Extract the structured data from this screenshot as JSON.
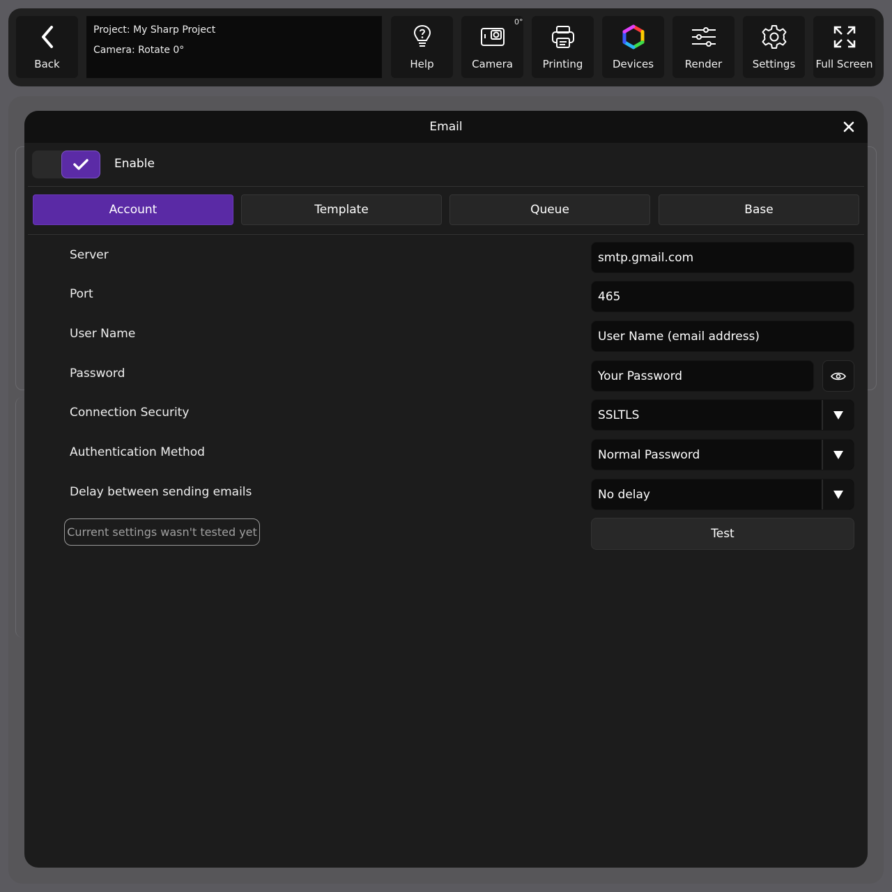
{
  "topbar": {
    "back_label": "Back",
    "project_line": "Project: My Sharp Project",
    "camera_line": "Camera: Rotate 0°",
    "camera_angle": "0°",
    "buttons": [
      {
        "label": "Help",
        "icon": "help-bulb-icon"
      },
      {
        "label": "Camera",
        "icon": "camera-icon"
      },
      {
        "label": "Printing",
        "icon": "printer-icon"
      },
      {
        "label": "Devices",
        "icon": "devices-rainbow-hexagon-icon"
      },
      {
        "label": "Render",
        "icon": "sliders-icon"
      },
      {
        "label": "Settings",
        "icon": "gear-icon"
      },
      {
        "label": "Full Screen",
        "icon": "fullscreen-icon"
      }
    ]
  },
  "dialog": {
    "title": "Email",
    "enable_label": "Enable",
    "enabled": true,
    "tabs": [
      {
        "label": "Account",
        "active": true
      },
      {
        "label": "Template",
        "active": false
      },
      {
        "label": "Queue",
        "active": false
      },
      {
        "label": "Base",
        "active": false
      }
    ],
    "fields": {
      "server": {
        "label": "Server",
        "value": "smtp.gmail.com"
      },
      "port": {
        "label": "Port",
        "value": "465"
      },
      "username": {
        "label": "User Name",
        "placeholder": "User Name (email address)"
      },
      "password": {
        "label": "Password",
        "placeholder": "Your Password"
      },
      "security": {
        "label": "Connection Security",
        "value": "SSLTLS"
      },
      "auth": {
        "label": "Authentication Method",
        "value": "Normal Password"
      },
      "delay": {
        "label": "Delay between sending emails",
        "value": "No delay"
      }
    },
    "status_text": "Current settings wasn't tested yet",
    "test_label": "Test"
  },
  "colors": {
    "accent": "#5a2aa5",
    "background": "#1c1c1c",
    "header": "#111111"
  }
}
